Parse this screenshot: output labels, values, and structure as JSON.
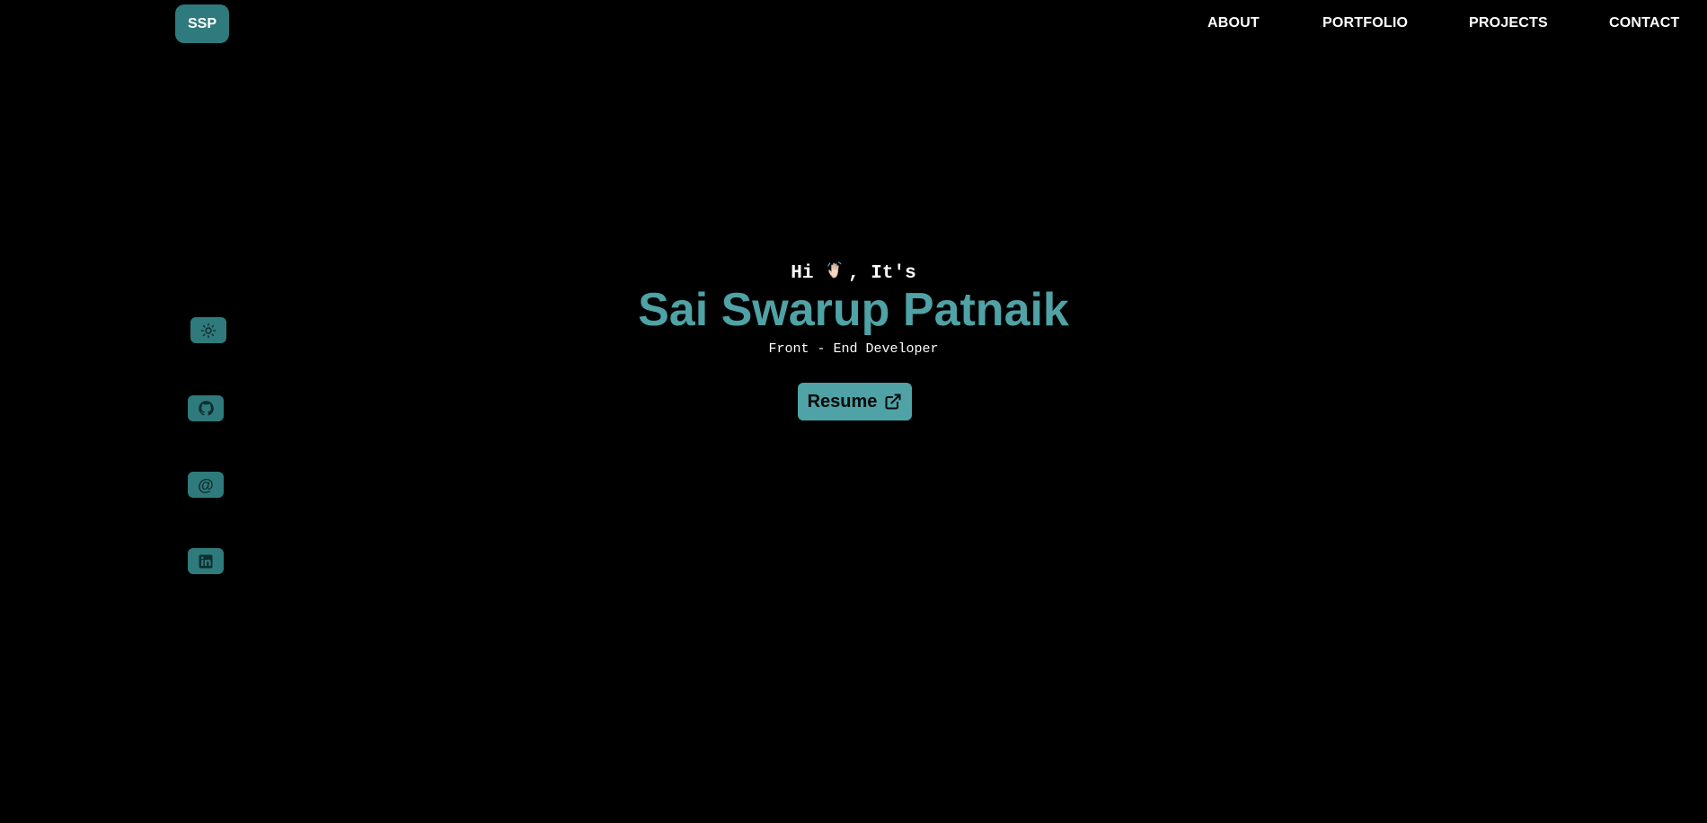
{
  "header": {
    "logo_text": "SSP",
    "nav": [
      {
        "label": "ABOUT"
      },
      {
        "label": "PORTFOLIO"
      },
      {
        "label": "PROJECTS"
      },
      {
        "label": "CONTACT"
      }
    ]
  },
  "sidebar": {
    "icons": [
      "sun-icon",
      "github-icon",
      "email-icon",
      "linkedin-icon"
    ],
    "email_glyph": "@"
  },
  "hero": {
    "greeting_prefix": "Hi ",
    "greeting_suffix": ", It's",
    "name": "Sai Swarup Patnaik",
    "role": "Front - End Developer",
    "resume_label": "Resume"
  },
  "colors": {
    "background": "#000000",
    "accent": "#4fa2a5",
    "accent_dark": "#2f7a7c",
    "text": "#ffffff"
  }
}
